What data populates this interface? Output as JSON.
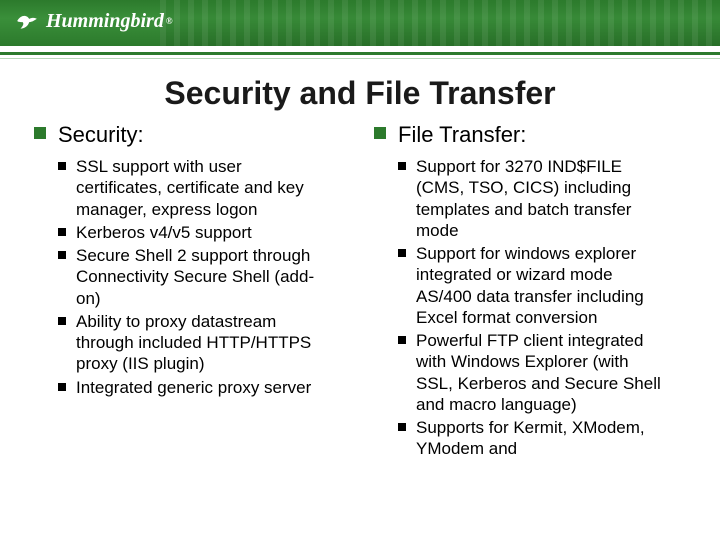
{
  "brand": "Hummingbird",
  "title": "Security and File Transfer",
  "left": {
    "heading": "Security:",
    "items": [
      "SSL support with user certificates, certificate and key manager, express logon",
      "Kerberos v4/v5 support",
      "Secure Shell 2 support through Connectivity Secure Shell (add-on)",
      "Ability to proxy datastream through included HTTP/HTTPS proxy (IIS plugin)",
      "Integrated generic proxy server"
    ]
  },
  "right": {
    "heading": "File Transfer:",
    "items": [
      "Support for 3270 IND$FILE (CMS, TSO, CICS) including templates and batch transfer mode",
      "Support for windows explorer integrated or wizard mode AS/400 data transfer including Excel format conversion",
      "Powerful FTP client integrated with Windows Explorer (with SSL, Kerberos and Secure Shell and macro language)",
      "Supports for Kermit, XModem, YModem and"
    ]
  }
}
